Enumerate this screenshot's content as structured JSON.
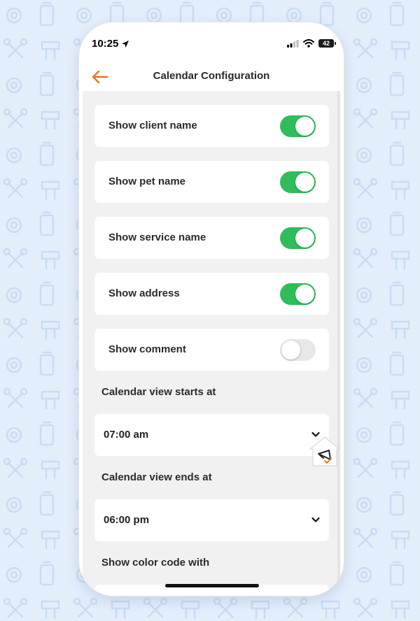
{
  "status_bar": {
    "time": "10:25",
    "battery": "42"
  },
  "header": {
    "title": "Calendar Configuration"
  },
  "toggles": [
    {
      "label": "Show client name",
      "on": true
    },
    {
      "label": "Show pet name",
      "on": true
    },
    {
      "label": "Show service name",
      "on": true
    },
    {
      "label": "Show address",
      "on": true
    },
    {
      "label": "Show comment",
      "on": false
    }
  ],
  "calendar_start": {
    "label": "Calendar view starts at",
    "value": "07:00 am"
  },
  "calendar_end": {
    "label": "Calendar view ends at",
    "value": "06:00 pm"
  },
  "color_code": {
    "label": "Show color code with"
  },
  "colors": {
    "accent": "#e8752a",
    "toggle_on": "#2fbd5b",
    "toggle_off": "#e8e8ea",
    "page_bg": "#e3eefb"
  }
}
